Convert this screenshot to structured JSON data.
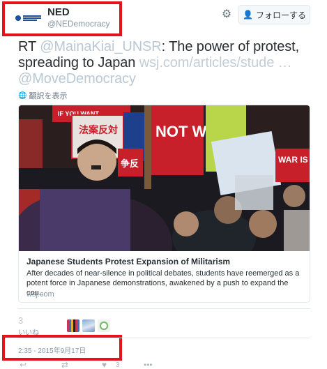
{
  "account": {
    "name": "NED",
    "handle": "@NEDemocracy"
  },
  "header": {
    "follow_label": "フォローする",
    "settings_icon": "gear-icon",
    "follow_icon": "add-person-icon"
  },
  "tweet": {
    "prefix": "RT ",
    "mention": "@MainaKiai_UNSR",
    "text": ": The power of protest, spreading to Japan ",
    "link": "wsj.com/articles/stude …",
    "mention2": "@MoveDemocracy",
    "translate_label": "翻訳を表示"
  },
  "card": {
    "title": "Japanese Students Protest Expansion of Militarism",
    "description": "After decades of near-silence in political debates, students have reemerged as a potent force in Japanese demonstrations, awakened by a push to expand the cou...",
    "domain": "wsj.com",
    "image_signs": {
      "sign1": "IF YOU WANT",
      "sign2": "法案反対",
      "sign3": "NOT WAR",
      "sign4": "WAR IS",
      "sign5": "争反"
    }
  },
  "stats": {
    "likes_count": "3",
    "likes_label": "いいね"
  },
  "timestamp": "2:35 - 2015年9月17日",
  "actions": {
    "reply_icon": "reply-icon",
    "retweet_icon": "retweet-icon",
    "like_icon": "heart-icon",
    "like_count": "3",
    "more_icon": "more-icon"
  },
  "colors": {
    "highlight": "#e3131b",
    "link": "#bac8d3",
    "accent": "#55acee"
  }
}
